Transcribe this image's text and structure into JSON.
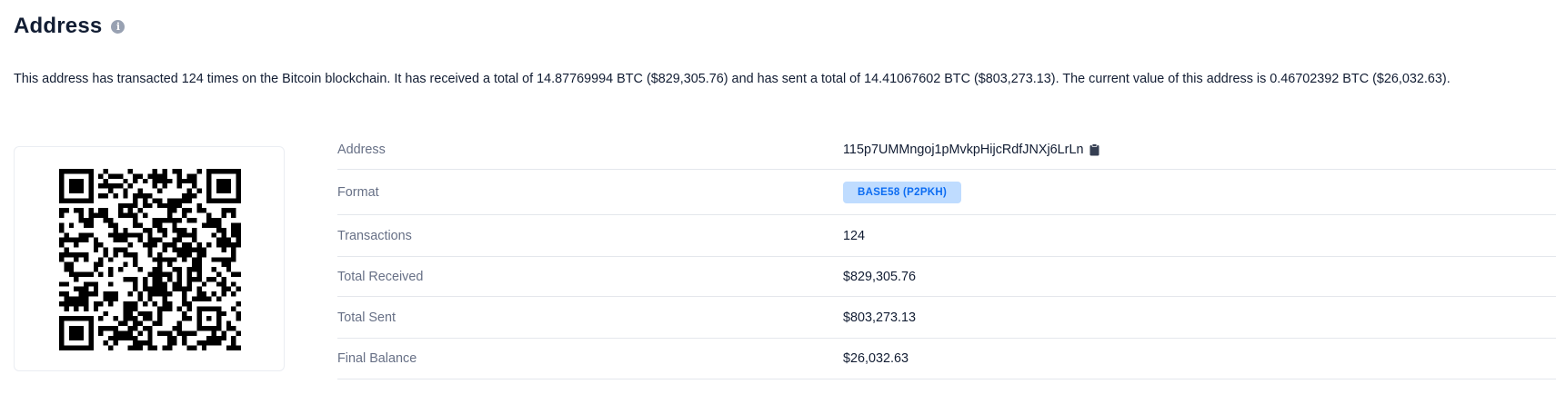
{
  "header": {
    "title": "Address"
  },
  "summary": {
    "text": "This address has transacted 124 times on the Bitcoin blockchain. It has received a total of 14.87769994 BTC ($829,305.76) and has sent a total of 14.41067602 BTC ($803,273.13). The current value of this address is 0.46702392 BTC ($26,032.63)."
  },
  "details": {
    "rows": [
      {
        "label": "Address",
        "value": "115p7UMMngoj1pMvkpHijcRdfJNXj6LrLn"
      },
      {
        "label": "Format",
        "value": "BASE58 (P2PKH)"
      },
      {
        "label": "Transactions",
        "value": "124"
      },
      {
        "label": "Total Received",
        "value": "$829,305.76"
      },
      {
        "label": "Total Sent",
        "value": "$803,273.13"
      },
      {
        "label": "Final Balance",
        "value": "$26,032.63"
      }
    ]
  },
  "colors": {
    "badge_bg": "#bfdcff",
    "badge_text": "#0c6cf2",
    "label_text": "#677086",
    "value_text": "#121d33"
  },
  "icons": {
    "info": "info-circle-icon",
    "copy": "clipboard-icon",
    "qr": "qr-code"
  }
}
